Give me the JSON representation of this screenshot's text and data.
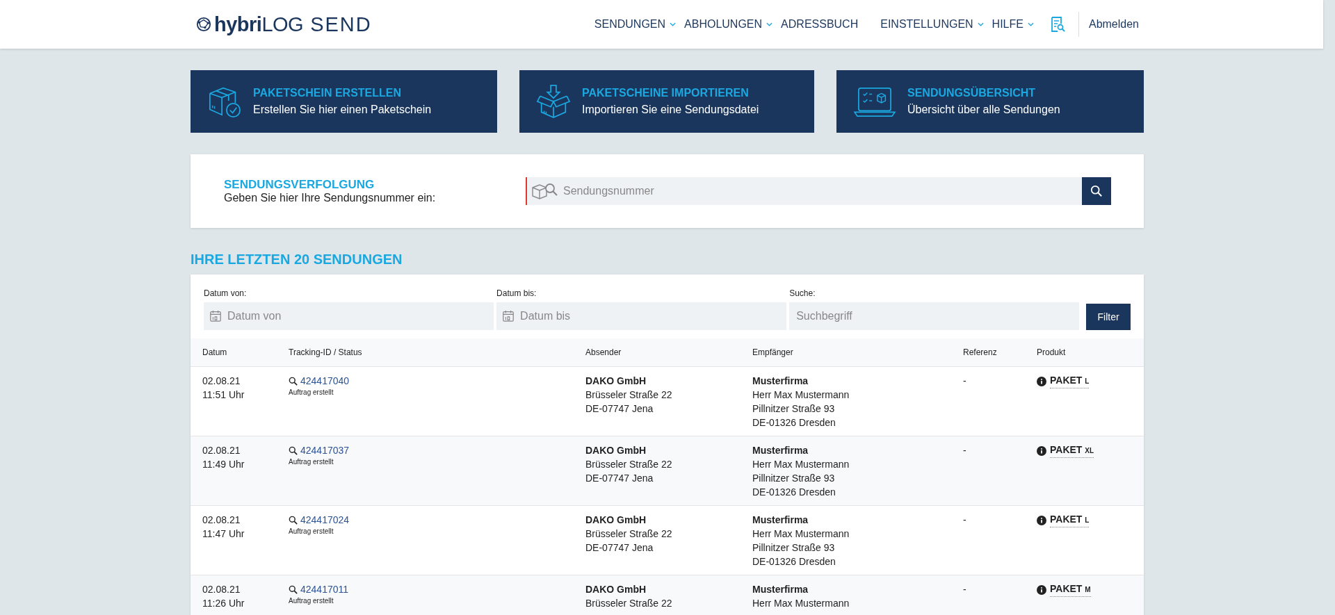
{
  "header": {
    "logo_bold": "hybri",
    "logo_rest": "LOG",
    "logo_product": "SEND",
    "nav": [
      {
        "label": "SENDUNGEN",
        "dropdown": true
      },
      {
        "label": "ABHOLUNGEN",
        "dropdown": true
      },
      {
        "label": "ADRESSBUCH",
        "dropdown": false
      },
      {
        "label": "EINSTELLUNGEN",
        "dropdown": true
      },
      {
        "label": "HILFE",
        "dropdown": true
      }
    ],
    "logout": "Abmelden"
  },
  "action_cards": [
    {
      "kind": "create",
      "title": "PAKETSCHEIN ERSTELLEN",
      "subtitle": "Erstellen Sie hier einen Paketschein"
    },
    {
      "kind": "import",
      "title": "PAKETSCHEINE IMPORTIEREN",
      "subtitle": "Importieren Sie eine Sendungsdatei"
    },
    {
      "kind": "overview",
      "title": "SENDUNGSÜBERSICHT",
      "subtitle": "Übersicht über alle Sendungen"
    }
  ],
  "tracking": {
    "title": "SENDUNGSVERFOLGUNG",
    "subtitle": "Geben Sie hier Ihre Sendungsnummer ein:",
    "placeholder": "Sendungsnummer"
  },
  "recent": {
    "title": "IHRE LETZTEN 20 SENDUNGEN",
    "filters": [
      {
        "kind": "date",
        "label": "Datum von:",
        "placeholder": "Datum von"
      },
      {
        "kind": "date",
        "label": "Datum bis:",
        "placeholder": "Datum bis"
      },
      {
        "kind": "text",
        "label": "Suche:",
        "placeholder": "Suchbegriff"
      }
    ],
    "filter_button": "Filter",
    "table": {
      "columns": [
        "Datum",
        "Tracking-ID / Status",
        "Absender",
        "Empfänger",
        "Referenz",
        "Produkt"
      ],
      "rows": [
        {
          "date": "02.08.21",
          "time": "11:51 Uhr",
          "tracking_id": "424417040",
          "status": "Auftrag erstellt",
          "sender": [
            "DAKO GmbH",
            "Brüsseler Straße 22",
            "DE-07747 Jena"
          ],
          "recipient": [
            "Musterfirma",
            "Herr Max Mustermann",
            "Pillnitzer Straße 93",
            "DE-01326 Dresden"
          ],
          "reference": "-",
          "product": "PAKET",
          "size": "L"
        },
        {
          "date": "02.08.21",
          "time": "11:49 Uhr",
          "tracking_id": "424417037",
          "status": "Auftrag erstellt",
          "sender": [
            "DAKO GmbH",
            "Brüsseler Straße 22",
            "DE-07747 Jena"
          ],
          "recipient": [
            "Musterfirma",
            "Herr Max Mustermann",
            "Pillnitzer Straße 93",
            "DE-01326 Dresden"
          ],
          "reference": "-",
          "product": "PAKET",
          "size": "XL"
        },
        {
          "date": "02.08.21",
          "time": "11:47 Uhr",
          "tracking_id": "424417024",
          "status": "Auftrag erstellt",
          "sender": [
            "DAKO GmbH",
            "Brüsseler Straße 22",
            "DE-07747 Jena"
          ],
          "recipient": [
            "Musterfirma",
            "Herr Max Mustermann",
            "Pillnitzer Straße 93",
            "DE-01326 Dresden"
          ],
          "reference": "-",
          "product": "PAKET",
          "size": "L"
        },
        {
          "date": "02.08.21",
          "time": "11:26 Uhr",
          "tracking_id": "424417011",
          "status": "Auftrag erstellt",
          "sender": [
            "DAKO GmbH",
            "Brüsseler Straße 22"
          ],
          "recipient": [
            "Musterfirma",
            "Herr Max Mustermann"
          ],
          "reference": "-",
          "product": "PAKET",
          "size": "M"
        }
      ]
    }
  }
}
